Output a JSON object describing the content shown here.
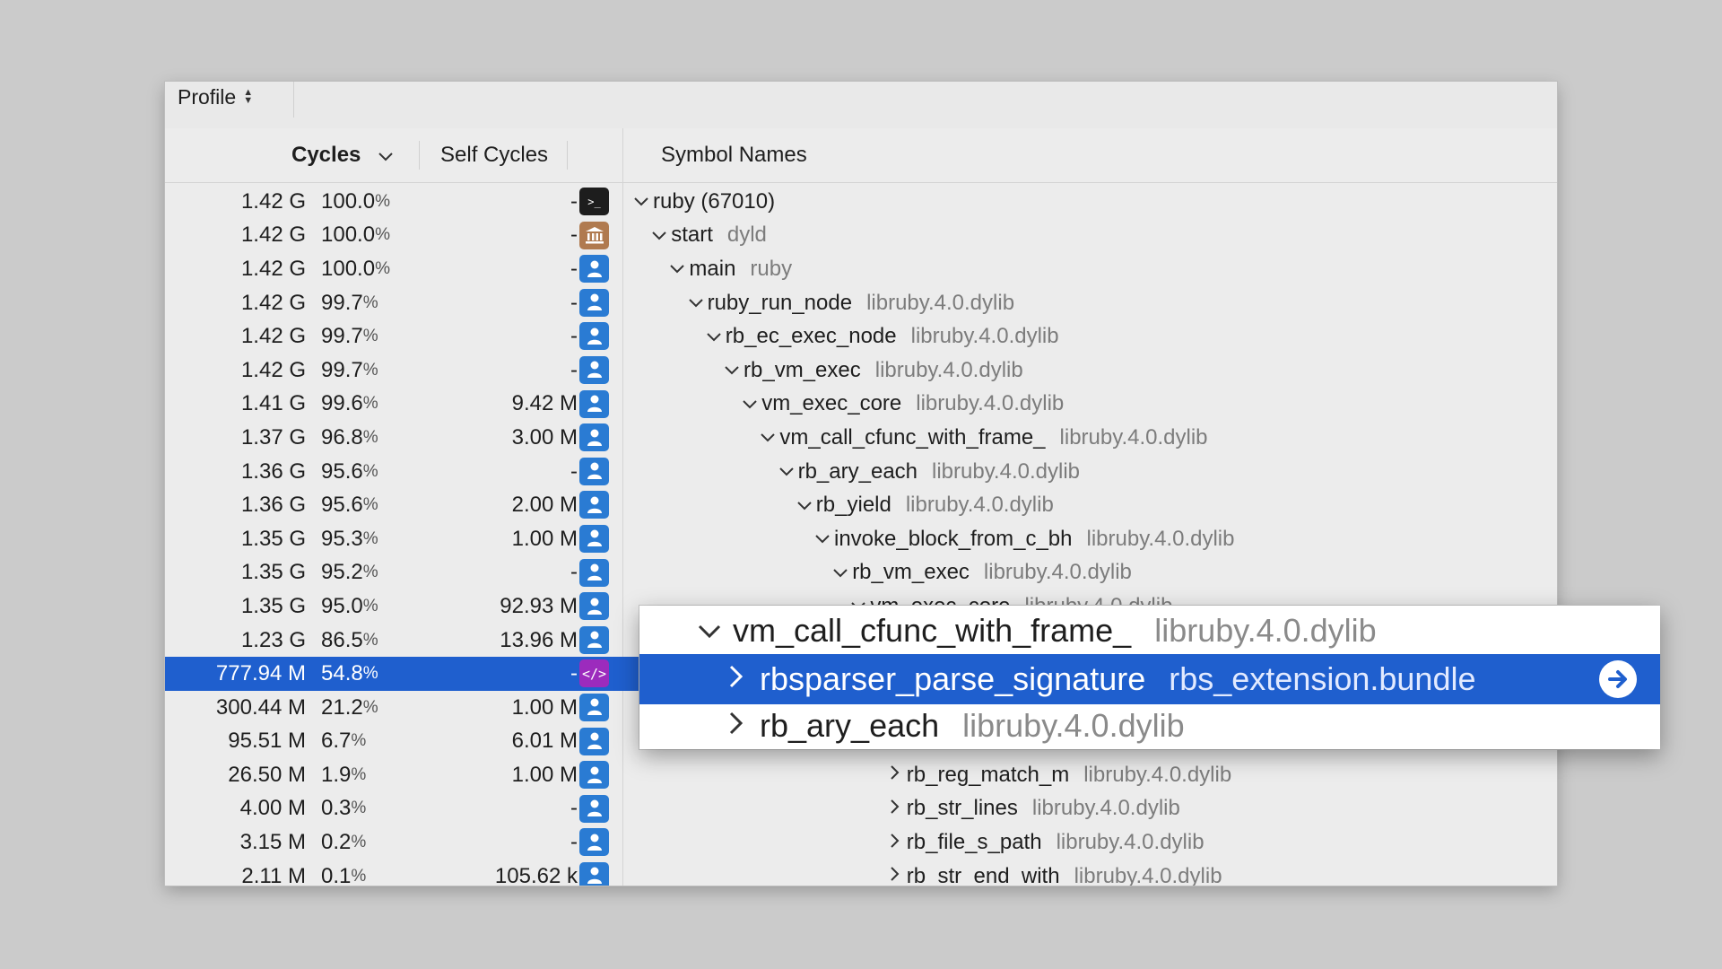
{
  "toolbar": {
    "profile_label": "Profile"
  },
  "columns": {
    "cycles": "Cycles",
    "self_cycles": "Self Cycles",
    "symbol_names": "Symbol Names"
  },
  "rows": [
    {
      "cycles": "1.42 G",
      "pct": "100.0",
      "self": "-",
      "kind": "terminal",
      "depth": 0,
      "expanded": true,
      "symbol": "ruby (67010)",
      "lib": ""
    },
    {
      "cycles": "1.42 G",
      "pct": "100.0",
      "self": "-",
      "kind": "system",
      "depth": 1,
      "expanded": true,
      "symbol": "start",
      "lib": "dyld"
    },
    {
      "cycles": "1.42 G",
      "pct": "100.0",
      "self": "-",
      "kind": "user",
      "depth": 2,
      "expanded": true,
      "symbol": "main",
      "lib": "ruby"
    },
    {
      "cycles": "1.42 G",
      "pct": "99.7",
      "self": "-",
      "kind": "user",
      "depth": 3,
      "expanded": true,
      "symbol": "ruby_run_node",
      "lib": "libruby.4.0.dylib"
    },
    {
      "cycles": "1.42 G",
      "pct": "99.7",
      "self": "-",
      "kind": "user",
      "depth": 4,
      "expanded": true,
      "symbol": "rb_ec_exec_node",
      "lib": "libruby.4.0.dylib"
    },
    {
      "cycles": "1.42 G",
      "pct": "99.7",
      "self": "-",
      "kind": "user",
      "depth": 5,
      "expanded": true,
      "symbol": "rb_vm_exec",
      "lib": "libruby.4.0.dylib"
    },
    {
      "cycles": "1.41 G",
      "pct": "99.6",
      "self": "9.42 M",
      "kind": "user",
      "depth": 6,
      "expanded": true,
      "symbol": "vm_exec_core",
      "lib": "libruby.4.0.dylib"
    },
    {
      "cycles": "1.37 G",
      "pct": "96.8",
      "self": "3.00 M",
      "kind": "user",
      "depth": 7,
      "expanded": true,
      "symbol": "vm_call_cfunc_with_frame_",
      "lib": "libruby.4.0.dylib"
    },
    {
      "cycles": "1.36 G",
      "pct": "95.6",
      "self": "-",
      "kind": "user",
      "depth": 8,
      "expanded": true,
      "symbol": "rb_ary_each",
      "lib": "libruby.4.0.dylib"
    },
    {
      "cycles": "1.36 G",
      "pct": "95.6",
      "self": "2.00 M",
      "kind": "user",
      "depth": 9,
      "expanded": true,
      "symbol": "rb_yield",
      "lib": "libruby.4.0.dylib"
    },
    {
      "cycles": "1.35 G",
      "pct": "95.3",
      "self": "1.00 M",
      "kind": "user",
      "depth": 10,
      "expanded": true,
      "symbol": "invoke_block_from_c_bh",
      "lib": "libruby.4.0.dylib"
    },
    {
      "cycles": "1.35 G",
      "pct": "95.2",
      "self": "-",
      "kind": "user",
      "depth": 11,
      "expanded": true,
      "symbol": "rb_vm_exec",
      "lib": "libruby.4.0.dylib"
    },
    {
      "cycles": "1.35 G",
      "pct": "95.0",
      "self": "92.93 M",
      "kind": "user",
      "depth": 12,
      "expanded": true,
      "symbol": "vm_exec_core",
      "lib": "libruby.4.0.dylib"
    },
    {
      "cycles": "1.23 G",
      "pct": "86.5",
      "self": "13.96 M",
      "kind": "user",
      "depth": 13,
      "expanded": true,
      "symbol": "",
      "lib": ""
    },
    {
      "cycles": "777.94 M",
      "pct": "54.8",
      "self": "-",
      "kind": "code",
      "depth": 14,
      "expanded": false,
      "symbol": "",
      "lib": "",
      "selected": true
    },
    {
      "cycles": "300.44 M",
      "pct": "21.2",
      "self": "1.00 M",
      "kind": "user",
      "depth": 14,
      "expanded": false,
      "symbol": "",
      "lib": ""
    },
    {
      "cycles": "95.51 M",
      "pct": "6.7",
      "self": "6.01 M",
      "kind": "user",
      "depth": 14,
      "expanded": false,
      "symbol": "",
      "lib": ""
    },
    {
      "cycles": "26.50 M",
      "pct": "1.9",
      "self": "1.00 M",
      "kind": "user",
      "depth": 14,
      "expanded": false,
      "symbol": "rb_reg_match_m",
      "lib": "libruby.4.0.dylib"
    },
    {
      "cycles": "4.00 M",
      "pct": "0.3",
      "self": "-",
      "kind": "user",
      "depth": 14,
      "expanded": false,
      "symbol": "rb_str_lines",
      "lib": "libruby.4.0.dylib"
    },
    {
      "cycles": "3.15 M",
      "pct": "0.2",
      "self": "-",
      "kind": "user",
      "depth": 14,
      "expanded": false,
      "symbol": "rb_file_s_path",
      "lib": "libruby.4.0.dylib"
    },
    {
      "cycles": "2.11 M",
      "pct": "0.1",
      "self": "105.62 k",
      "kind": "user",
      "depth": 14,
      "expanded": false,
      "symbol": "rb_str_end_with",
      "lib": "libruby.4.0.dylib"
    }
  ],
  "popup": [
    {
      "symbol": "vm_call_cfunc_with_frame_",
      "lib": "libruby.4.0.dylib",
      "expanded": true,
      "indent": 0
    },
    {
      "symbol": "rbsparser_parse_signature",
      "lib": "rbs_extension.bundle",
      "expanded": false,
      "indent": 1,
      "selected": true
    },
    {
      "symbol": "rb_ary_each",
      "lib": "libruby.4.0.dylib",
      "expanded": false,
      "indent": 1
    }
  ],
  "colors": {
    "selection": "#1f5fce",
    "user_icon": "#2a7bd3",
    "system_icon": "#b07a4f",
    "code_icon": "#9c2bbd"
  }
}
